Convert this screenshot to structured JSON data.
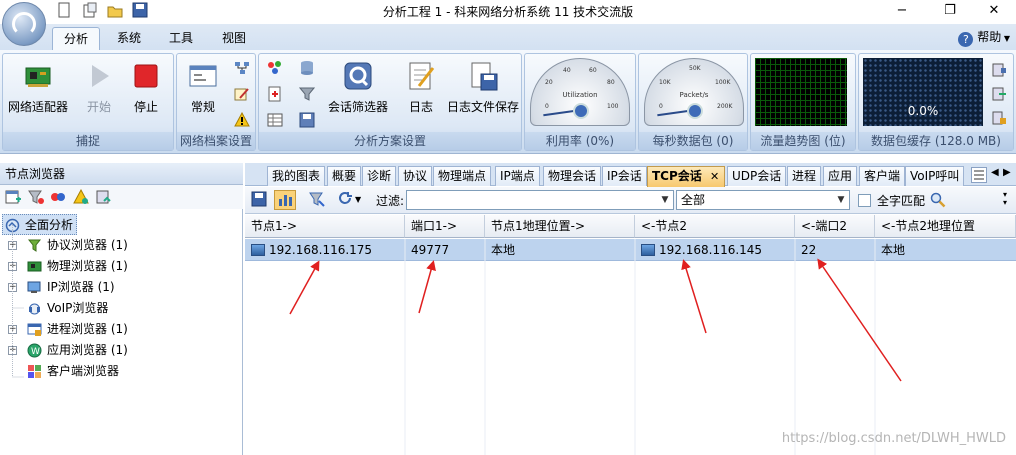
{
  "window": {
    "title": "分析工程 1 - 科来网络分析系统 11 技术交流版",
    "minimize": "−",
    "restore": "❐",
    "close": "✕"
  },
  "ribbon_tabs": [
    "分析",
    "系统",
    "工具",
    "视图"
  ],
  "help_label": "帮助",
  "groups": {
    "capture": {
      "title": "捕捉",
      "adapter": "网络适配器",
      "start": "开始",
      "stop": "停止"
    },
    "profile": {
      "title": "网络档案设置",
      "normal": "常规"
    },
    "scheme": {
      "title": "分析方案设置",
      "filter": "会话筛选器",
      "log": "日志",
      "logsave": "日志文件保存"
    },
    "util": {
      "title": "利用率 (0%)",
      "gauge_label": "Utilization",
      "ticks": [
        "0",
        "20",
        "40",
        "60",
        "80",
        "100"
      ]
    },
    "pps": {
      "title": "每秒数据包 (0)",
      "gauge_label": "Packet/s",
      "ticks": [
        "0",
        "10K",
        "50K",
        "100K",
        "200K"
      ]
    },
    "trend": {
      "title": "流量趋势图 (位)"
    },
    "buffer": {
      "title": "数据包缓存 (128.0 MB)",
      "percent": "0.0%"
    }
  },
  "left_panel": {
    "title": "节点浏览器",
    "items": [
      {
        "label": "全面分析",
        "expander": false,
        "icon": "analysis-icon"
      },
      {
        "label": "协议浏览器 (1)",
        "expander": true,
        "icon": "protocol-icon"
      },
      {
        "label": "物理浏览器 (1)",
        "expander": true,
        "icon": "physical-icon"
      },
      {
        "label": "IP浏览器 (1)",
        "expander": true,
        "icon": "ip-icon"
      },
      {
        "label": "VoIP浏览器",
        "expander": false,
        "icon": "voip-icon"
      },
      {
        "label": "进程浏览器 (1)",
        "expander": true,
        "icon": "process-icon"
      },
      {
        "label": "应用浏览器 (1)",
        "expander": true,
        "icon": "app-icon"
      },
      {
        "label": "客户端浏览器",
        "expander": false,
        "icon": "client-icon"
      }
    ]
  },
  "doc_tabs": [
    "我的图表",
    "概要",
    "诊断",
    "协议",
    "物理端点",
    "IP端点",
    "物理会话",
    "IP会话",
    "TCP会话",
    "UDP会话",
    "进程",
    "应用",
    "客户端",
    "VoIP呼叫"
  ],
  "active_tab_close": "✕",
  "toolbar": {
    "filter_label": "过滤:",
    "filter_value": "",
    "scope_value": "全部",
    "match_label": "全字匹配"
  },
  "table": {
    "columns": [
      "节点1->",
      "端口1->",
      "节点1地理位置->",
      "<-节点2",
      "<-端口2",
      "<-节点2地理位置"
    ],
    "rows": [
      [
        "192.168.116.175",
        "49777",
        "本地",
        "192.168.116.145",
        "22",
        "本地"
      ]
    ]
  },
  "watermark": "https://blog.csdn.net/DLWH_HWLD"
}
